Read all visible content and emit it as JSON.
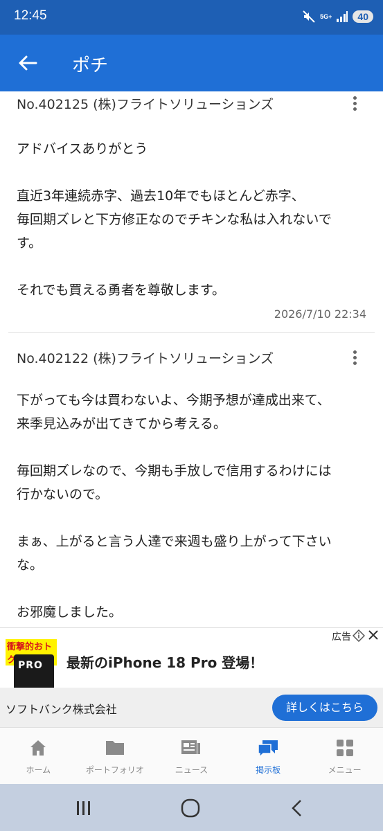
{
  "status_bar": {
    "time": "12:45",
    "network": "5G+",
    "battery": "40",
    "icons": [
      "mute-icon",
      "network-5g-icon",
      "signal-icon",
      "battery-icon"
    ]
  },
  "app_bar": {
    "title": "ポチ",
    "back_icon": "arrow-left-icon"
  },
  "posts": [
    {
      "number": "No.402125 (株)フライトソリューションズ",
      "lines": [
        "アドバイスありがとう",
        "",
        "直近3年連続赤字、過去10年でもほとんど赤字、",
        "毎回期ズレと下方修正なのでチキンな私は入れないで",
        "す。",
        "",
        "それでも買える勇者を尊敬します。"
      ],
      "date": "2026/7/10 22:34"
    },
    {
      "number": "No.402122 (株)フライトソリューションズ",
      "lines": [
        "下がっても今は買わないよ、今期予想が達成出来て、",
        "来季見込みが出てきてから考える。",
        "",
        "毎回期ズレなので、今期も手放しで信用するわけには",
        "行かないので。",
        "",
        "まぁ、上がると言う人達で来週も盛り上がって下さい",
        "な。",
        "",
        "お邪魔しました。"
      ]
    }
  ],
  "ad": {
    "label": "広告",
    "promo": "衝撃的おトク!",
    "phone_label": "PRO",
    "title": "最新のiPhone 18 Pro 登場！",
    "company": "ソフトバンク株式会社",
    "cta": "詳しくはこちら"
  },
  "bottom_nav": {
    "items": [
      {
        "label": "ホーム",
        "icon": "home-icon"
      },
      {
        "label": "ポートフォリオ",
        "icon": "folder-icon"
      },
      {
        "label": "ニュース",
        "icon": "news-icon"
      },
      {
        "label": "掲示板",
        "icon": "chat-bubbles-icon",
        "active": true
      },
      {
        "label": "メニュー",
        "icon": "grid-menu-icon"
      }
    ],
    "active_color": "#1f6fd6"
  },
  "colors": {
    "status_bar": "#1e5fb4",
    "app_bar": "#1f6fd6",
    "system_nav": "#c4cfe0"
  }
}
